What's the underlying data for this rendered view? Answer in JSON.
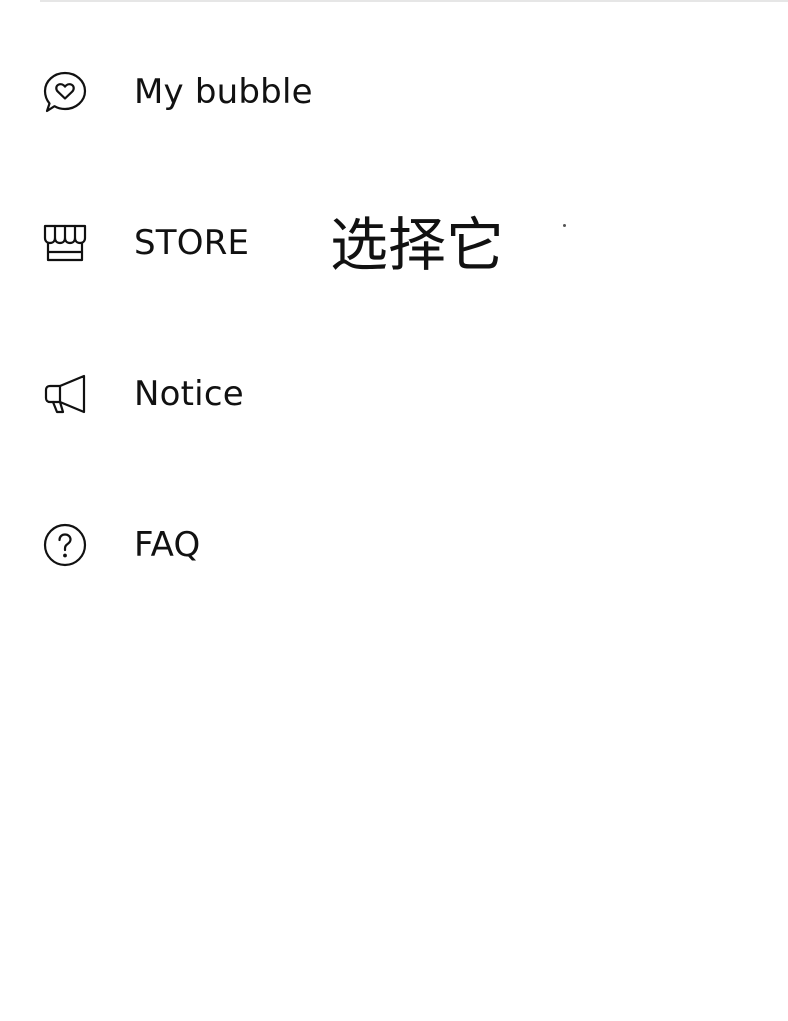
{
  "menu": {
    "items": [
      {
        "label": "My bubble",
        "icon": "heart-chat-bubble-icon"
      },
      {
        "label": "STORE",
        "icon": "store-awning-icon"
      },
      {
        "label": "Notice",
        "icon": "megaphone-icon"
      },
      {
        "label": "FAQ",
        "icon": "question-circle-icon"
      }
    ]
  },
  "annotation": {
    "text": "选择它"
  }
}
